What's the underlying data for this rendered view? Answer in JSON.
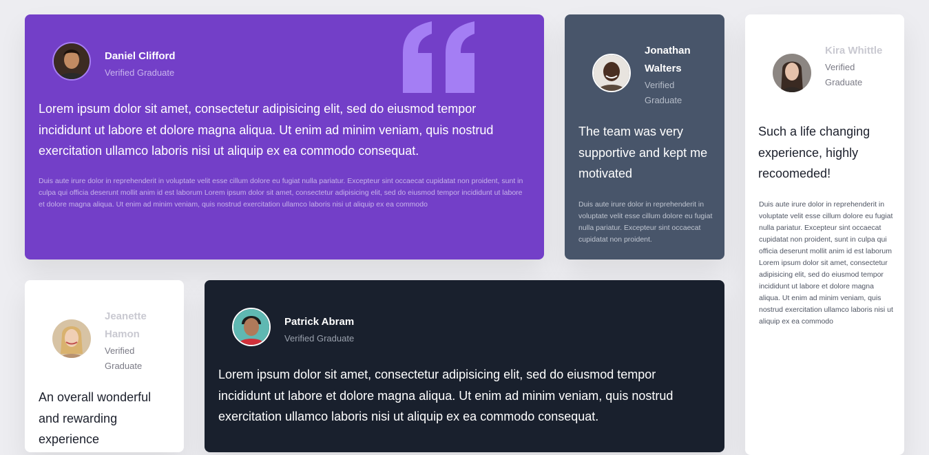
{
  "testimonials": {
    "daniel": {
      "name": "Daniel Clifford",
      "role": "Verified Graduate",
      "headline": "Lorem ipsum dolor sit amet, consectetur adipisicing elit, sed do eiusmod tempor incididunt ut labore et dolore magna aliqua. Ut enim ad minim veniam, quis nostrud exercitation ullamco laboris nisi ut aliquip ex ea commodo consequat.",
      "body": "Duis aute irure dolor in reprehenderit in voluptate velit esse cillum dolore eu fugiat nulla pariatur. Excepteur sint occaecat cupidatat non proident, sunt in culpa qui officia deserunt mollit anim id est laborum Lorem ipsum dolor sit amet, consectetur adipisicing elit, sed do eiusmod tempor incididunt ut labore et dolore magna aliqua. Ut enim ad minim veniam, quis nostrud exercitation ullamco laboris nisi ut aliquip ex ea commodo"
    },
    "jonathan": {
      "name": "Jonathan Walters",
      "role": "Verified Graduate",
      "headline": "The team was very supportive and kept me motivated",
      "body": "Duis aute irure dolor in reprehenderit in voluptate velit esse cillum dolore eu fugiat nulla pariatur. Excepteur sint occaecat cupidatat non proident."
    },
    "kira": {
      "name": "Kira Whittle",
      "role": "Verified Graduate",
      "headline": "Such a life changing experience, highly recoomeded!",
      "body": "Duis aute irure dolor in reprehenderit in voluptate velit esse cillum dolore eu fugiat nulla pariatur. Excepteur sint occaecat cupidatat non proident, sunt in culpa qui officia deserunt mollit anim id est laborum Lorem ipsum dolor sit amet, consectetur adipisicing elit, sed do eiusmod tempor incididunt ut labore et dolore magna aliqua. Ut enim ad minim veniam, quis nostrud exercitation ullamco laboris nisi ut aliquip ex ea commodo"
    },
    "jeanette": {
      "name": "Jeanette Hamon",
      "role": "Verified Graduate",
      "headline": "An overall wonderful and rewarding experience"
    },
    "patrick": {
      "name": "Patrick Abram",
      "role": "Verified Graduate",
      "headline": "Lorem ipsum dolor sit amet, consectetur adipisicing elit, sed do eiusmod tempor incididunt ut labore et dolore magna aliqua. Ut enim ad minim veniam, quis nostrud exercitation ullamco laboris nisi ut aliquip ex ea commodo consequat."
    }
  },
  "colors": {
    "page_bg": "#ededf1",
    "purple_card": "#733fc8",
    "slate_card": "#48556a",
    "dark_card": "#19202d",
    "white_card": "#ffffff",
    "quote_mark": "#a47ef4"
  },
  "icons": {
    "quote": "quote-icon"
  }
}
